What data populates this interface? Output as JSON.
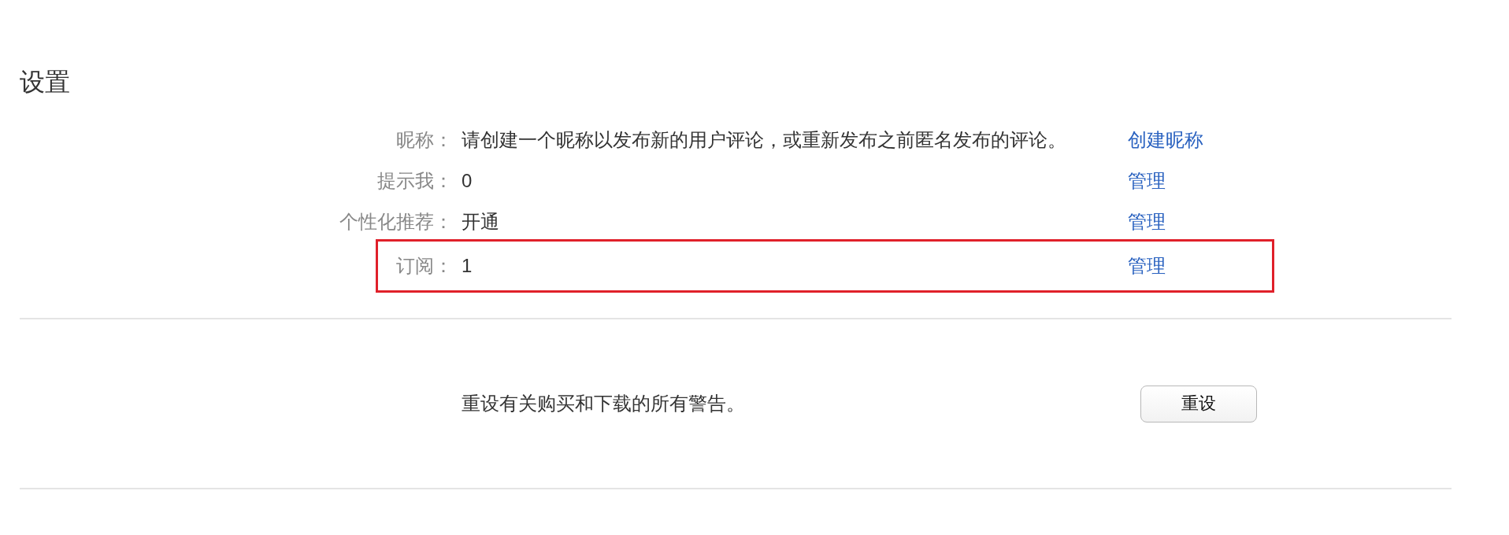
{
  "title": "设置",
  "rows": [
    {
      "label": "昵称：",
      "value": "请创建一个昵称以发布新的用户评论，或重新发布之前匿名发布的评论。",
      "link": "创建昵称",
      "highlighted": false
    },
    {
      "label": "提示我：",
      "value": "0",
      "link": "管理",
      "highlighted": false
    },
    {
      "label": "个性化推荐：",
      "value": "开通",
      "link": "管理",
      "highlighted": false
    },
    {
      "label": "订阅：",
      "value": "1",
      "link": "管理",
      "highlighted": true
    }
  ],
  "reset": {
    "description": "重设有关购买和下载的所有警告。",
    "button": "重设"
  }
}
